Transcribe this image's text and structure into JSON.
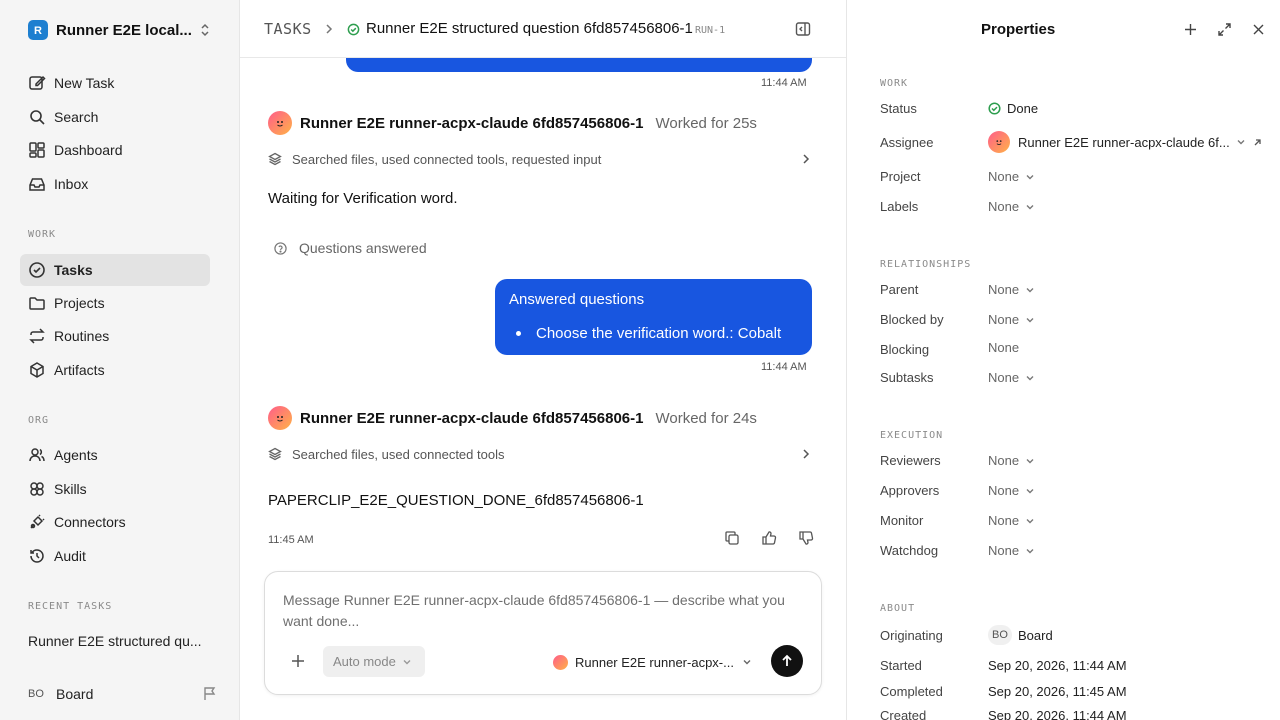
{
  "sidebar": {
    "workspace": "Runner E2E local...",
    "logo_letter": "R",
    "nav": [
      {
        "label": "New Task",
        "icon": "pencil-square-icon"
      },
      {
        "label": "Search",
        "icon": "search-icon"
      },
      {
        "label": "Dashboard",
        "icon": "grid-icon"
      },
      {
        "label": "Inbox",
        "icon": "inbox-icon"
      }
    ],
    "work_label": "WORK",
    "work": [
      {
        "label": "Tasks",
        "icon": "check-circle-icon",
        "active": true
      },
      {
        "label": "Projects",
        "icon": "folder-icon"
      },
      {
        "label": "Routines",
        "icon": "repeat-icon"
      },
      {
        "label": "Artifacts",
        "icon": "cube-icon"
      }
    ],
    "org_label": "ORG",
    "org": [
      {
        "label": "Agents",
        "icon": "users-icon"
      },
      {
        "label": "Skills",
        "icon": "layers-icon"
      },
      {
        "label": "Connectors",
        "icon": "plug-icon"
      },
      {
        "label": "Audit",
        "icon": "history-icon"
      }
    ],
    "recent_label": "RECENT TASKS",
    "recent": [
      "Runner E2E structured qu..."
    ],
    "user": {
      "initials": "BO",
      "name": "Board"
    }
  },
  "header": {
    "section": "TASKS",
    "title": "Runner E2E structured question 6fd857456806-1",
    "run": "RUN-1"
  },
  "thread": {
    "time_1": "11:44 AM",
    "agent_1": {
      "name": "Runner E2E runner-acpx-claude 6fd857456806-1",
      "worked": "Worked for 25s",
      "activity": "Searched files, used connected tools, requested input"
    },
    "waiting": "Waiting for Verification word.",
    "questions_answered": "Questions answered",
    "bubble": {
      "title": "Answered questions",
      "item": "Choose the verification word.: Cobalt"
    },
    "time_2": "11:44 AM",
    "agent_2": {
      "name": "Runner E2E runner-acpx-claude 6fd857456806-1",
      "worked": "Worked for 24s",
      "activity": "Searched files, used connected tools"
    },
    "done": "PAPERCLIP_E2E_QUESTION_DONE_6fd857456806-1",
    "time_3": "11:45 AM"
  },
  "composer": {
    "placeholder": "Message Runner E2E runner-acpx-claude 6fd857456806-1 — describe what you want done...",
    "mode": "Auto mode",
    "agent": "Runner E2E runner-acpx-..."
  },
  "properties": {
    "title": "Properties",
    "work_label": "WORK",
    "status_label": "Status",
    "status": "Done",
    "assignee_label": "Assignee",
    "assignee": "Runner E2E runner-acpx-claude 6f...",
    "project_label": "Project",
    "project": "None",
    "labels_label": "Labels",
    "labels": "None",
    "rel_label": "RELATIONSHIPS",
    "parent_label": "Parent",
    "parent": "None",
    "blocked_label": "Blocked by",
    "blocked": "None",
    "blocking_label": "Blocking",
    "blocking": "None",
    "subtasks_label": "Subtasks",
    "subtasks": "None",
    "exec_label": "EXECUTION",
    "reviewers_label": "Reviewers",
    "reviewers": "None",
    "approvers_label": "Approvers",
    "approvers": "None",
    "monitor_label": "Monitor",
    "monitor": "None",
    "watchdog_label": "Watchdog",
    "watchdog": "None",
    "about_label": "ABOUT",
    "originating_label": "Originating",
    "originating_initials": "BO",
    "originating": "Board",
    "started_label": "Started",
    "started": "Sep 20, 2026, 11:44 AM",
    "completed_label": "Completed",
    "completed": "Sep 20, 2026, 11:45 AM",
    "created_label": "Created",
    "created": "Sep 20, 2026, 11:44 AM"
  },
  "colors": {
    "accent": "#1856e0",
    "success": "#2e9e4f"
  }
}
